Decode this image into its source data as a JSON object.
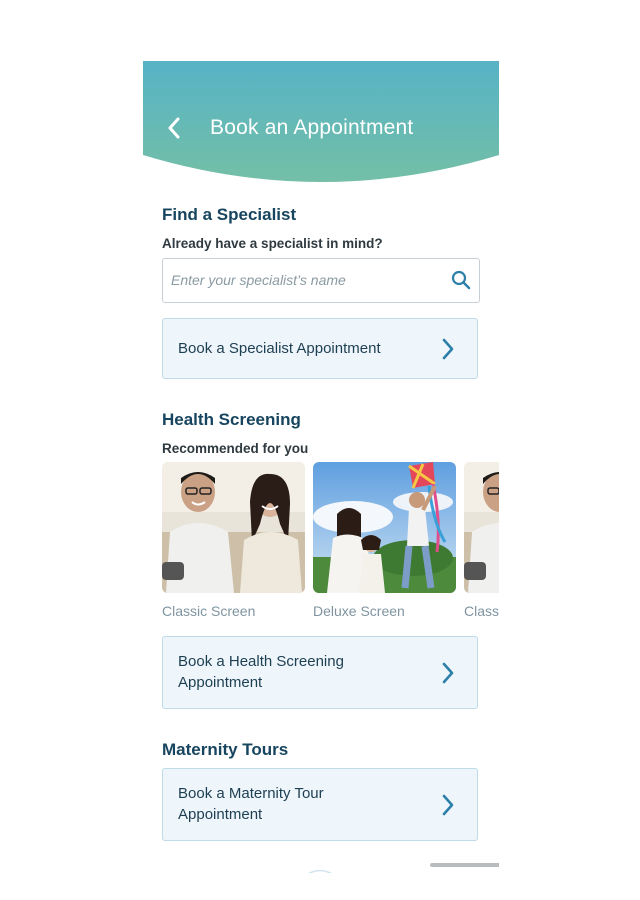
{
  "header": {
    "title": "Book an Appointment",
    "back_icon": "chevron-left-icon",
    "gradient_start": "#56b3c6",
    "gradient_end": "#74bfa6"
  },
  "specialist": {
    "heading": "Find a Specialist",
    "subheading": "Already have a specialist in mind?",
    "search_placeholder": "Enter your specialist’s name",
    "search_value": "",
    "search_icon": "search-icon",
    "book_label": "Book a Specialist Appointment"
  },
  "screening": {
    "heading": "Health Screening",
    "subheading": "Recommended for you",
    "packages": [
      {
        "label": "Classic Screen"
      },
      {
        "label": "Deluxe Screen"
      },
      {
        "label": "Classic Screen"
      }
    ],
    "book_label": "Book a Health Screening Appointment"
  },
  "maternity": {
    "heading": "Maternity Tours",
    "book_label": "Book a Maternity Tour Appointment"
  },
  "colors": {
    "heading": "#17455f",
    "card_bg": "#eef5fb",
    "card_border": "#bfdbe8",
    "accent": "#2b7fa8"
  }
}
